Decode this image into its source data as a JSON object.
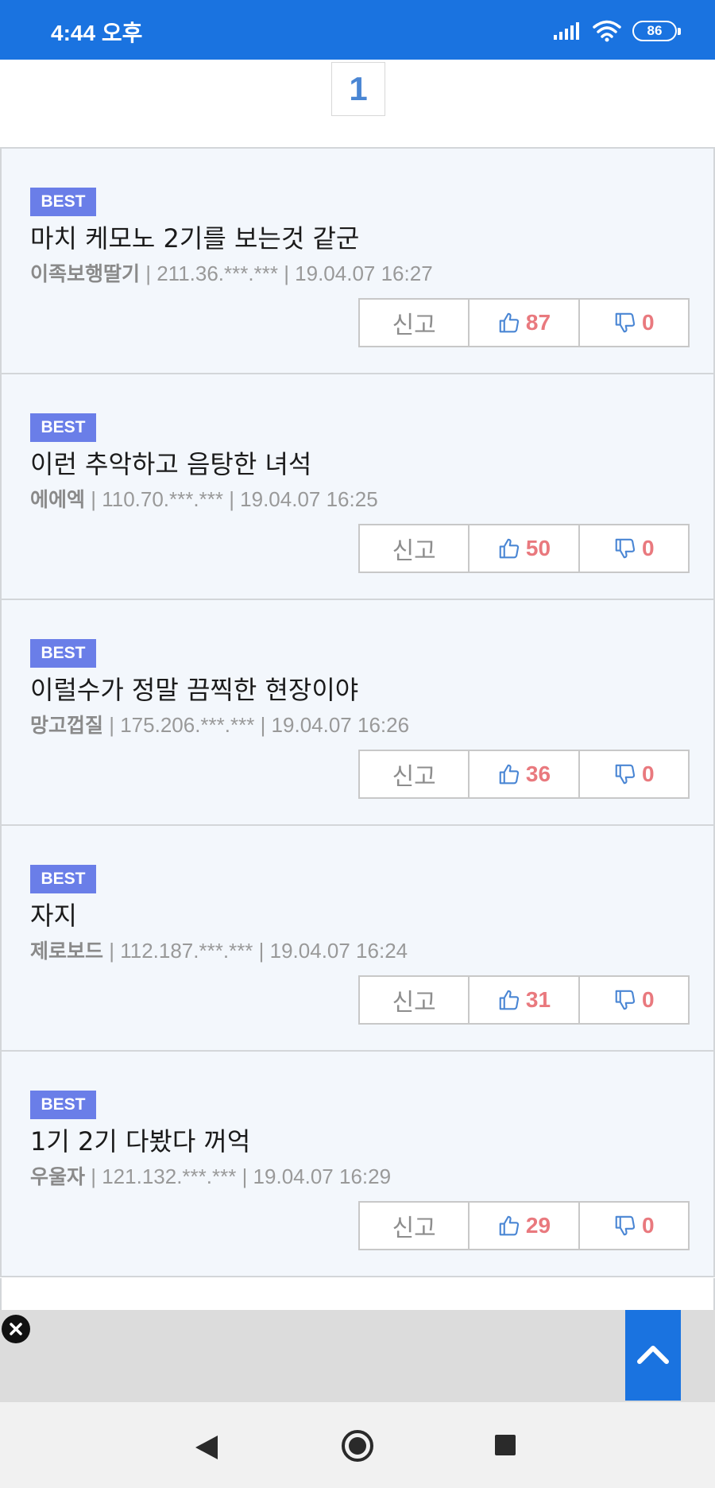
{
  "status_bar": {
    "time": "4:44 오후",
    "battery": "86"
  },
  "pagination": {
    "current_page": "1"
  },
  "comments": [
    {
      "badge": "BEST",
      "text": "마치 케모노 2기를 보는것 같군",
      "author": "이족보행딸기",
      "meta": " | 211.36.***.*** | 19.04.07 16:27",
      "report_label": "신고",
      "likes": "87",
      "dislikes": "0"
    },
    {
      "badge": "BEST",
      "text": "이런 추악하고 음탕한 녀석",
      "author": "에에엑",
      "meta": " | 110.70.***.*** | 19.04.07 16:25",
      "report_label": "신고",
      "likes": "50",
      "dislikes": "0"
    },
    {
      "badge": "BEST",
      "text": "이럴수가 정말 끔찍한 현장이야",
      "author": "망고껍질",
      "meta": " | 175.206.***.*** | 19.04.07 16:26",
      "report_label": "신고",
      "likes": "36",
      "dislikes": "0"
    },
    {
      "badge": "BEST",
      "text": "자지",
      "author": "제로보드",
      "meta": " | 112.187.***.*** | 19.04.07 16:24",
      "report_label": "신고",
      "likes": "31",
      "dislikes": "0"
    },
    {
      "badge": "BEST",
      "text": "1기 2기 다봤다 꺼억",
      "author": "우울자",
      "meta": " | 121.132.***.*** | 19.04.07 16:29",
      "report_label": "신고",
      "likes": "29",
      "dislikes": "0"
    }
  ],
  "icons": {
    "like": "thumbs-up-icon",
    "dislike": "thumbs-down-icon",
    "ad_close": "close-icon",
    "scroll_top": "chevron-up-icon"
  },
  "colors": {
    "primary": "#1a73e0",
    "badge": "#6a7ee8",
    "count": "#e9797e",
    "icon": "#4a86d4",
    "card_bg": "#f3f7fc"
  }
}
